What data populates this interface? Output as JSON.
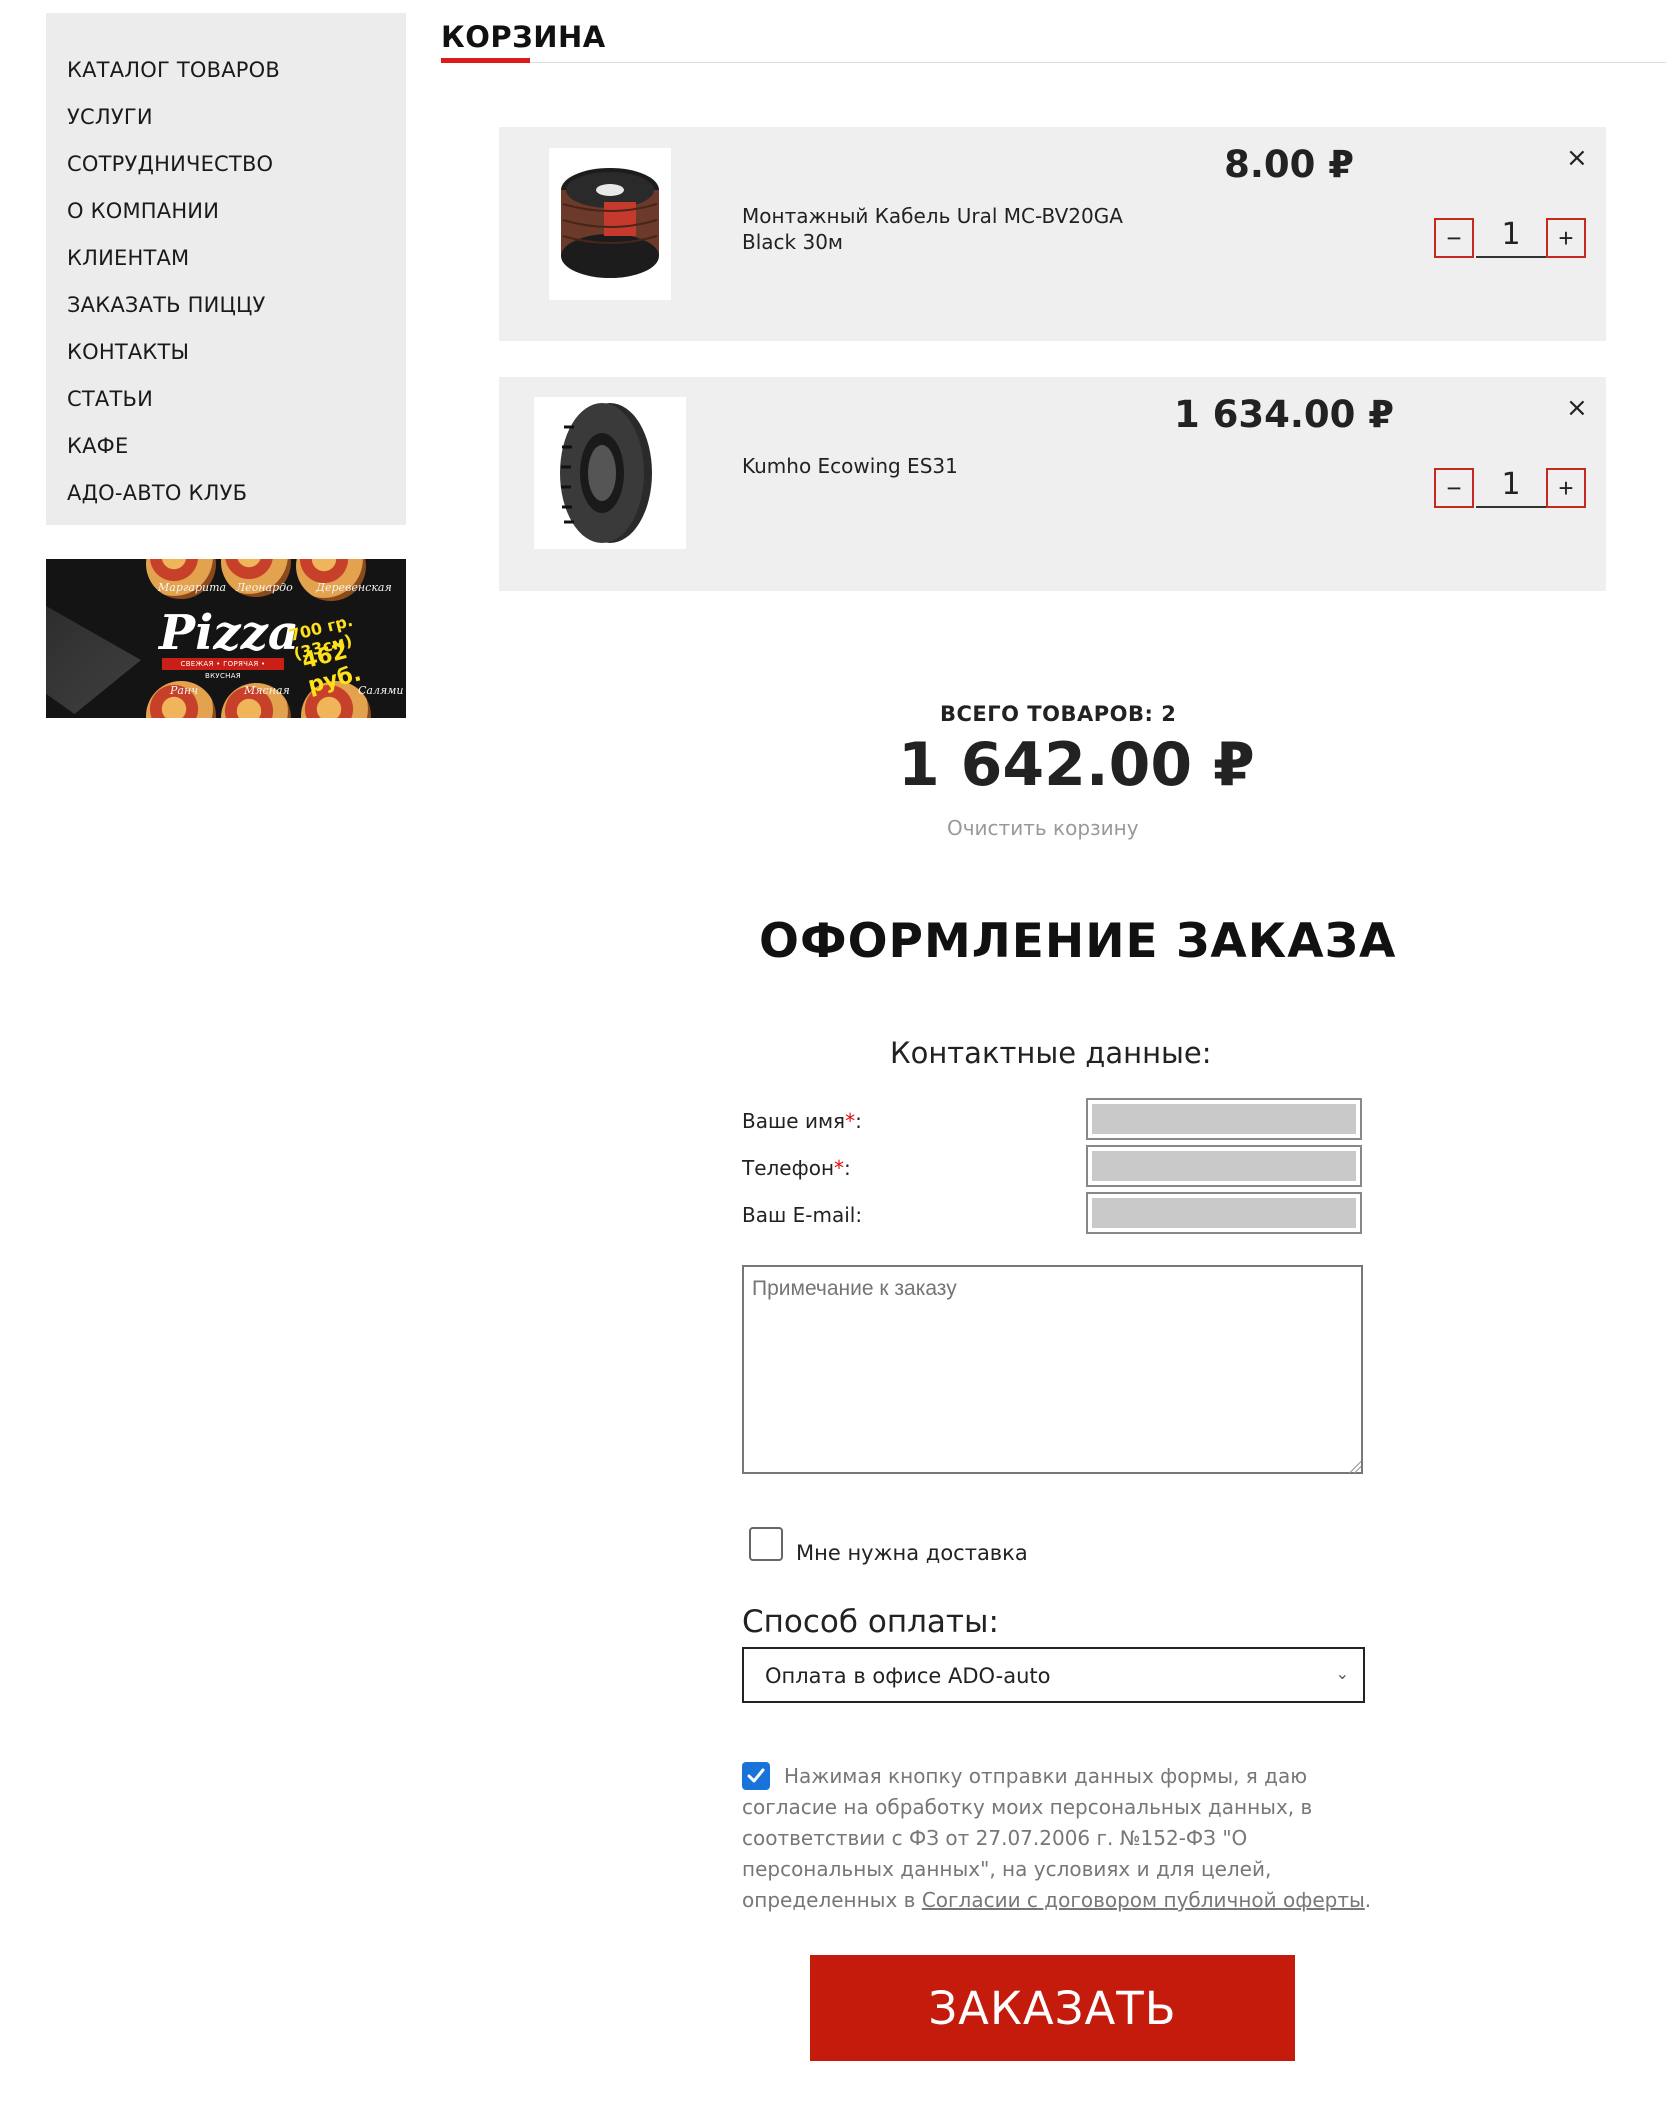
{
  "sidebar": {
    "items": [
      {
        "label": "КАТАЛОГ ТОВАРОВ"
      },
      {
        "label": "УСЛУГИ"
      },
      {
        "label": "СОТРУДНИЧЕСТВО"
      },
      {
        "label": "О КОМПАНИИ"
      },
      {
        "label": "КЛИЕНТАМ"
      },
      {
        "label": "ЗАКАЗАТЬ ПИЦЦУ"
      },
      {
        "label": "КОНТАКТЫ"
      },
      {
        "label": "СТАТЬИ"
      },
      {
        "label": "КАФЕ"
      },
      {
        "label": "АДО-АВТО КЛУБ"
      }
    ],
    "banner": {
      "title": "Pizza",
      "subtitle": "СВЕЖАЯ • ГОРЯЧАЯ • ВКУСНАЯ",
      "weight": "700 гр. (33см)",
      "price": "462 руб.",
      "pizza_names": [
        "Маргарита",
        "Леонардо",
        "Деревенская",
        "Ранч",
        "Мясная",
        "Салями"
      ]
    }
  },
  "cart": {
    "title": "КОРЗИНА",
    "accent_color": "#dd1a1a",
    "items": [
      {
        "name": "Монтажный Кабель Ural MC-BV20GA Black 30м",
        "price": "8.00 ₽",
        "quantity": "1",
        "image_icon": "cable-spool-image",
        "remove_icon": "×",
        "minus_label": "−",
        "plus_label": "+"
      },
      {
        "name": "Kumho Ecowing ES31",
        "price": "1 634.00 ₽",
        "quantity": "1",
        "image_icon": "tire-image",
        "remove_icon": "×",
        "minus_label": "−",
        "plus_label": "+"
      }
    ],
    "total_count_label": "ВСЕГО ТОВАРОВ: 2",
    "total_sum": "1 642.00 ₽",
    "clear_label": "Очистить корзину"
  },
  "checkout": {
    "title": "ОФОРМЛЕНИЕ ЗАКАЗА",
    "contacts_heading": "Контактные данные:",
    "fields": [
      {
        "label": "Ваше имя",
        "required": "*",
        "suffix": ":"
      },
      {
        "label": "Телефон",
        "required": "*",
        "suffix": ":"
      },
      {
        "label": "Ваш E-mail:",
        "required": "",
        "suffix": ""
      }
    ],
    "note_placeholder": "Примечание к заказу",
    "delivery_label": "Мне нужна доставка",
    "delivery_checked": false,
    "payment_heading": "Способ оплаты:",
    "payment_selected": "Оплата в офисе ADO-auto",
    "consent_checked": true,
    "consent_text": "Нажимая кнопку отправки данных формы, я даю согласие на обработку моих персональных данных, в соответствии с ФЗ от 27.07.2006 г. №152-ФЗ \"О персональных данных\", на условиях и для целей, определенных в ",
    "consent_link": "Согласии с договором публичной оферты",
    "consent_end": ".",
    "submit_label": "ЗАКАЗАТЬ",
    "submit_color": "#c41b0d"
  }
}
